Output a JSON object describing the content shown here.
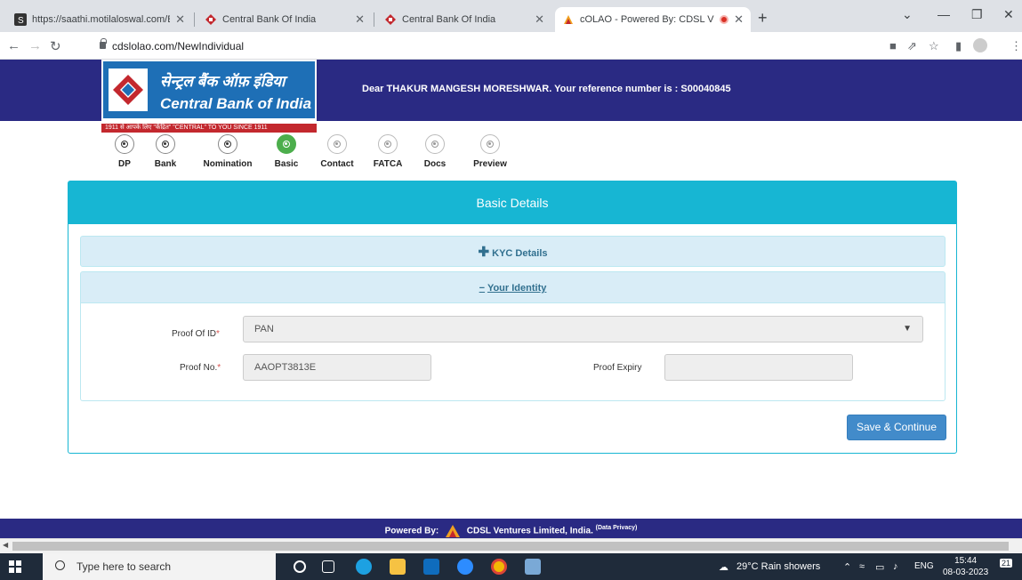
{
  "browser": {
    "tabs": [
      {
        "title": "https://saathi.motilaloswal.com/E"
      },
      {
        "title": "Central Bank Of India"
      },
      {
        "title": "Central Bank Of India"
      },
      {
        "title": "cOLAO - Powered By: CDSL V"
      }
    ],
    "url": "cdslolao.com/NewIndividual"
  },
  "header": {
    "bank_name_hindi": "सेन्ट्रल बैंक ऑफ़ इंडिया",
    "bank_name_english": "Central Bank of India",
    "tagline": "1911 से आपके लिए \"केंद्रित\"   \"CENTRAL\" TO YOU SINCE 1911",
    "greeting": "Dear THAKUR MANGESH MORESHWAR. Your reference number is : S00040845"
  },
  "steps": [
    {
      "label": "DP",
      "state": "done"
    },
    {
      "label": "Bank",
      "state": "done"
    },
    {
      "label": "Nomination",
      "state": "done"
    },
    {
      "label": "Basic",
      "state": "active"
    },
    {
      "label": "Contact",
      "state": "future"
    },
    {
      "label": "FATCA",
      "state": "future"
    },
    {
      "label": "Docs",
      "state": "future"
    },
    {
      "label": "Preview",
      "state": "future"
    }
  ],
  "form": {
    "title": "Basic Details",
    "kyc_section": "KYC Details",
    "identity_section": "Your Identity",
    "proof_of_id_label": "Proof Of ID",
    "proof_of_id_value": "PAN",
    "proof_no_label": "Proof No.",
    "proof_no_value": "AAOPT3813E",
    "proof_expiry_label": "Proof Expiry",
    "proof_expiry_value": "",
    "required_mark": "*",
    "save_button": "Save & Continue"
  },
  "footer": {
    "powered_by": "Powered By:",
    "company": "CDSL Ventures Limited, India.",
    "privacy": "(Data Privacy)"
  },
  "taskbar": {
    "search_placeholder": "Type here to search",
    "weather": "29°C  Rain showers",
    "language": "ENG",
    "time": "15:44",
    "date": "08-03-2023",
    "notifications": "21"
  },
  "colors": {
    "header_bg": "#2a2a83",
    "panel_accent": "#17b6d3",
    "active_step": "#4cae4c",
    "save_button": "#428bca"
  }
}
